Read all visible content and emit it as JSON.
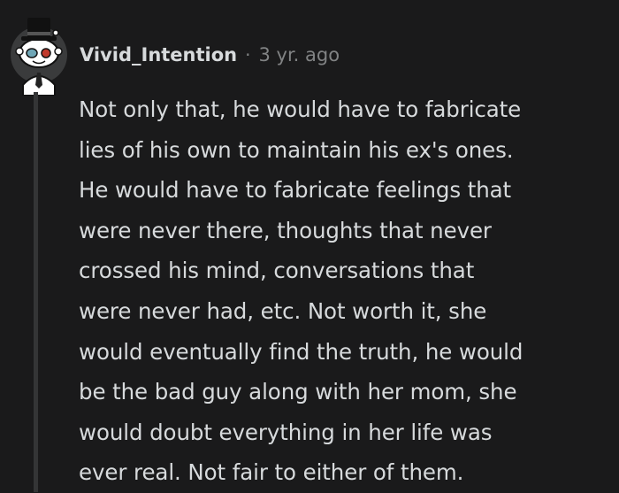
{
  "comment": {
    "author": "Vivid_Intention",
    "separator": "·",
    "timestamp": "3 yr. ago",
    "body_lines": [
      "Not only that, he would have to fabricate",
      "lies of his own to maintain his ex's ones.",
      "He would have to fabricate feelings that",
      "were never there, thoughts that never",
      "crossed his mind, conversations that",
      "were never had, etc. Not worth it, she",
      "would eventually find the truth, he would",
      "be the bad guy along with her mom, she",
      "would doubt everything in her life was",
      "ever real. Not fair to either of them."
    ]
  },
  "colors": {
    "background": "#1a1a1b",
    "text": "#d7dadc",
    "muted": "#818384",
    "thread_line": "#343536"
  },
  "icons": {
    "avatar": "snoo-avatar-with-top-hat"
  }
}
